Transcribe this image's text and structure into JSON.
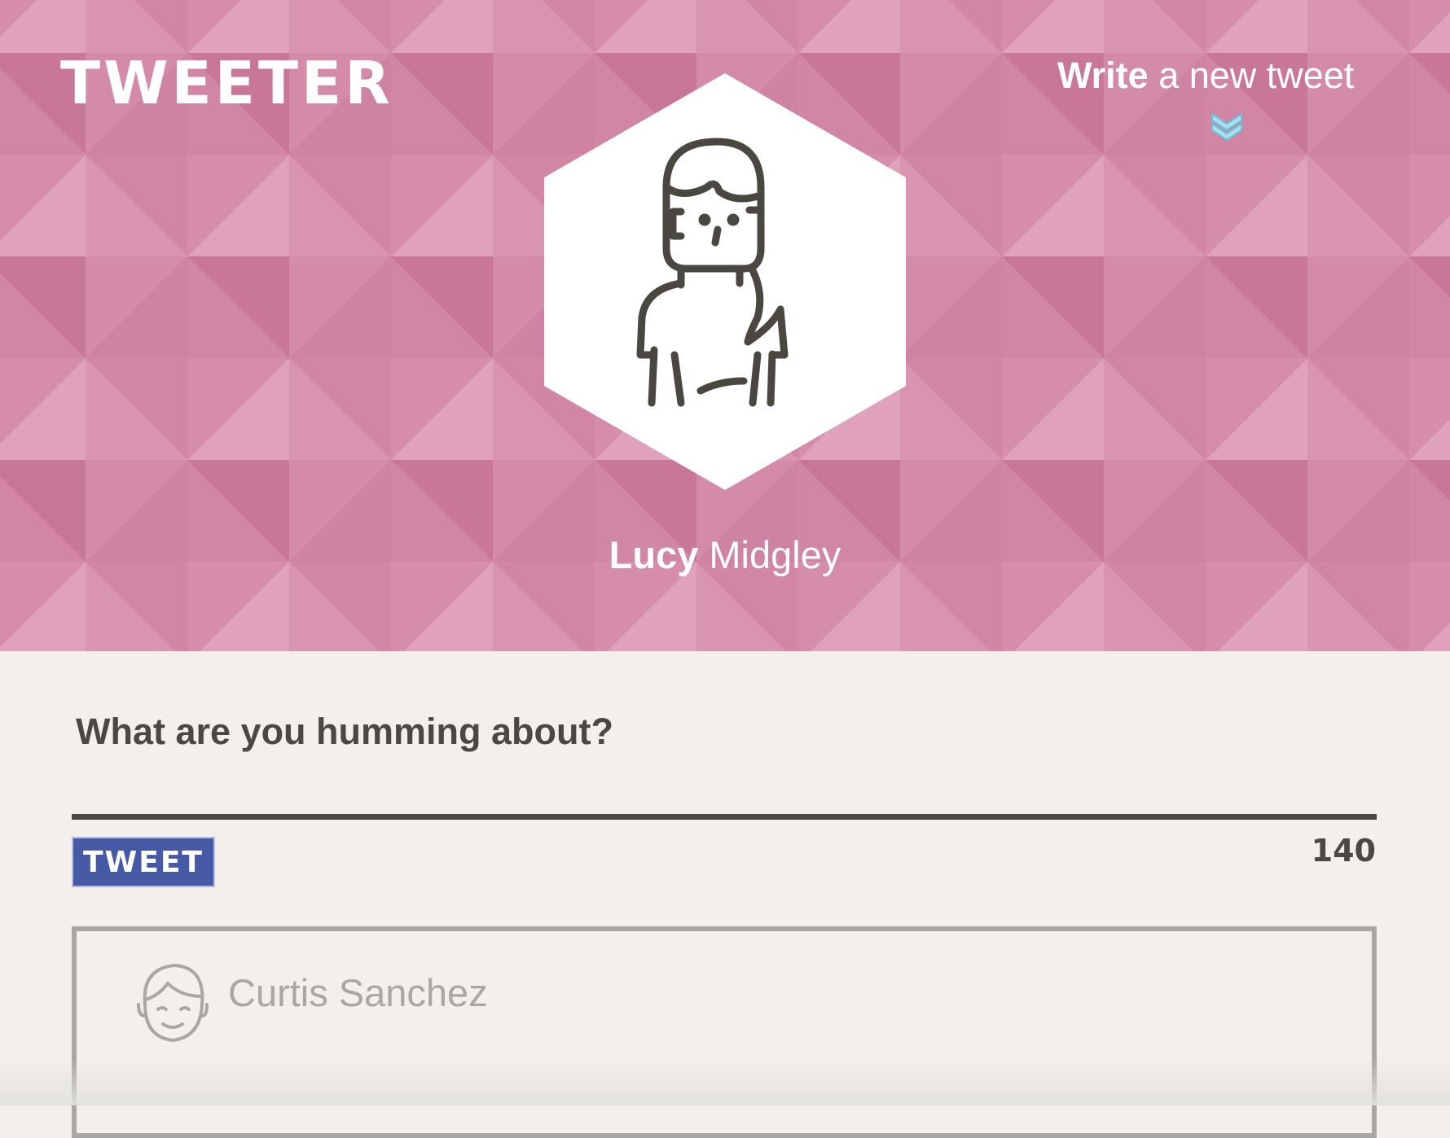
{
  "header": {
    "logo": "TWEETER",
    "write_link": {
      "bold": "Write",
      "rest": " a new tweet"
    },
    "chevron_icon": "double-chevron-down-icon",
    "user": {
      "first_name": "Lucy",
      "last_name": " Midgley"
    },
    "background_color": "#d186a4"
  },
  "compose": {
    "prompt": "What are you humming about?",
    "button_label": "TWEET",
    "char_count": "140",
    "button_color": "#4659a4"
  },
  "tweets": [
    {
      "author": "Curtis Sanchez",
      "avatar_icon": "smiling-face-icon"
    }
  ]
}
